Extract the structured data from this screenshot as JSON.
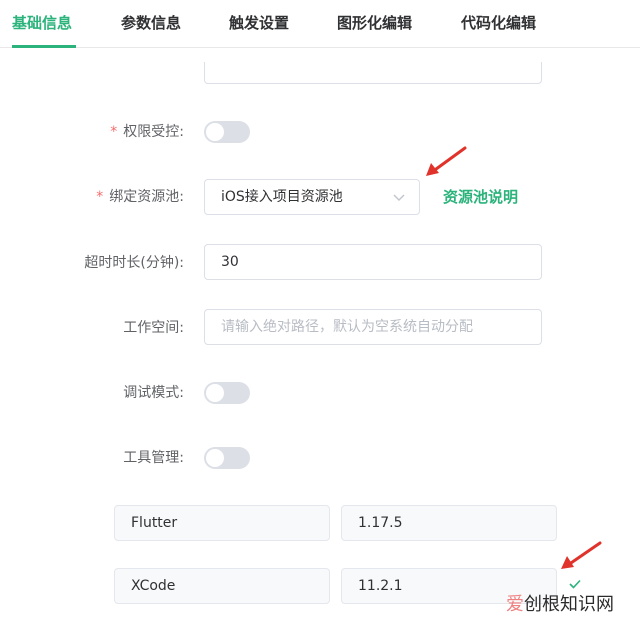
{
  "tabs": [
    {
      "label": "基础信息",
      "active": true
    },
    {
      "label": "参数信息",
      "active": false
    },
    {
      "label": "触发设置",
      "active": false
    },
    {
      "label": "图形化编辑",
      "active": false
    },
    {
      "label": "代码化编辑",
      "active": false
    }
  ],
  "form": {
    "permission": {
      "label": "权限受控:",
      "required": true,
      "enabled": false
    },
    "resource_pool": {
      "label": "绑定资源池:",
      "required": true,
      "value": "iOS接入项目资源池",
      "help_link": "资源池说明"
    },
    "timeout": {
      "label": "超时时长(分钟):",
      "value": "30"
    },
    "workspace": {
      "label": "工作空间:",
      "placeholder": "请输入绝对路径，默认为空系统自动分配"
    },
    "debug_mode": {
      "label": "调试模式:",
      "enabled": false
    },
    "tool_management": {
      "label": "工具管理:",
      "enabled": false
    },
    "tools": [
      {
        "name": "Flutter",
        "version": "1.17.5"
      },
      {
        "name": "XCode",
        "version": "11.2.1"
      }
    ]
  },
  "required_mark": "*",
  "colors": {
    "accent": "#2bb37b",
    "required": "#f56c6c",
    "annotation_arrow": "#e0332b"
  },
  "watermark": {
    "part1": "爱",
    "part2": "创根知识网"
  }
}
